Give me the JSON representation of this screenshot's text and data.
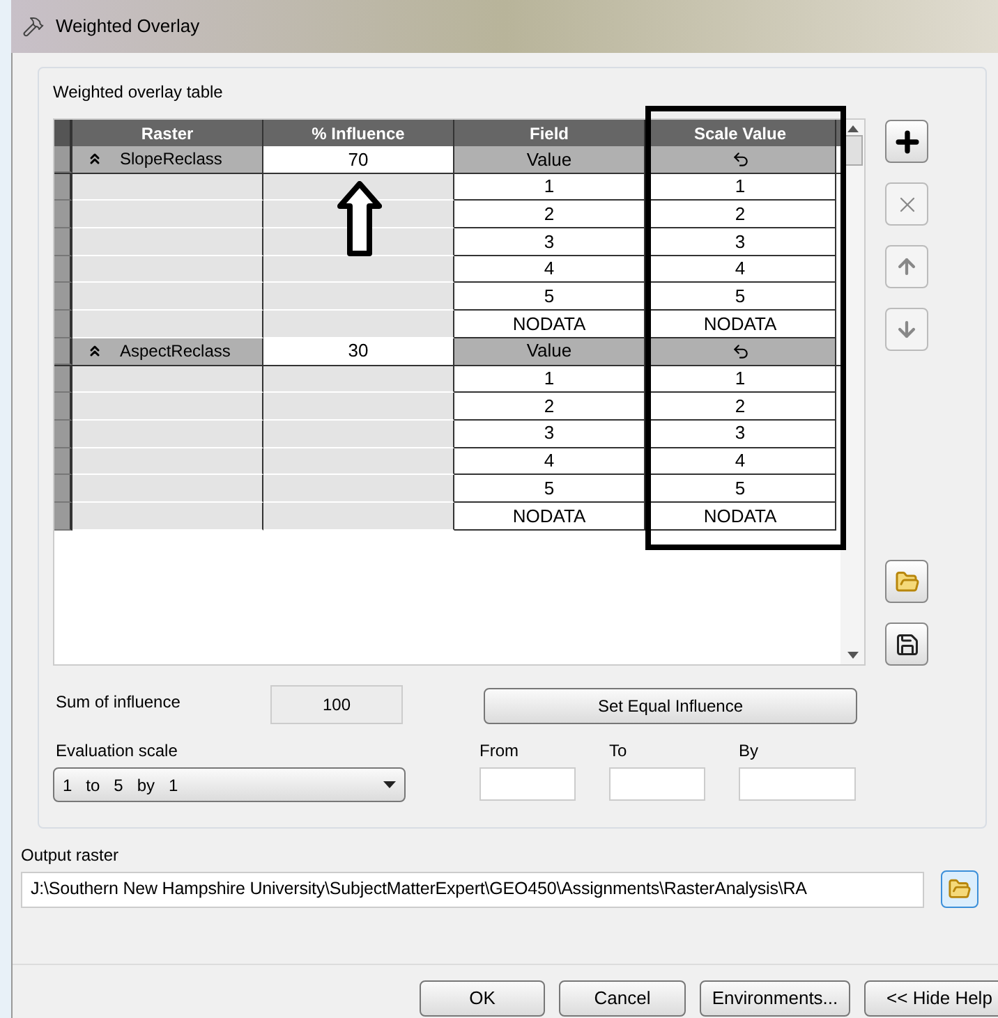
{
  "window": {
    "title": "Weighted Overlay"
  },
  "table": {
    "label": "Weighted overlay table",
    "columns": [
      "Raster",
      "% Influence",
      "Field",
      "Scale Value"
    ],
    "groups": [
      {
        "raster": "SlopeReclass",
        "influence": "70",
        "field": "Value",
        "rows": [
          {
            "field": "1",
            "scale": "1"
          },
          {
            "field": "2",
            "scale": "2"
          },
          {
            "field": "3",
            "scale": "3"
          },
          {
            "field": "4",
            "scale": "4"
          },
          {
            "field": "5",
            "scale": "5"
          },
          {
            "field": "NODATA",
            "scale": "NODATA"
          }
        ]
      },
      {
        "raster": "AspectReclass",
        "influence": "30",
        "field": "Value",
        "rows": [
          {
            "field": "1",
            "scale": "1"
          },
          {
            "field": "2",
            "scale": "2"
          },
          {
            "field": "3",
            "scale": "3"
          },
          {
            "field": "4",
            "scale": "4"
          },
          {
            "field": "5",
            "scale": "5"
          },
          {
            "field": "NODATA",
            "scale": "NODATA"
          }
        ]
      }
    ]
  },
  "sum_of_influence": {
    "label": "Sum of influence",
    "value": "100"
  },
  "set_equal_button": "Set Equal Influence",
  "evaluation_scale": {
    "label": "Evaluation scale",
    "value": "1   to   5   by   1"
  },
  "range_fields": [
    {
      "label": "From"
    },
    {
      "label": "To"
    },
    {
      "label": "By"
    }
  ],
  "output_raster": {
    "label": "Output raster",
    "value": "J:\\Southern New Hampshire University\\SubjectMatterExpert\\GEO450\\Assignments\\RasterAnalysis\\RA"
  },
  "buttons": [
    "OK",
    "Cancel",
    "Environments...",
    "<< Hide Help"
  ]
}
